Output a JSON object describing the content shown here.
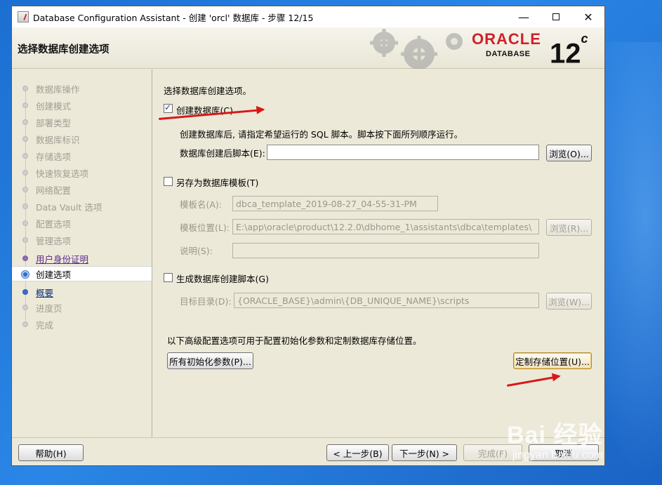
{
  "window": {
    "title": "Database Configuration Assistant - 创建 'orcl' 数据库 - 步骤 12/15",
    "controls": {
      "minimize": "—",
      "maximize": "",
      "close": "✕"
    }
  },
  "banner": {
    "page_title": "选择数据库创建选项",
    "logo_word": "ORACLE",
    "logo_sub": "DATABASE",
    "version": "12",
    "version_suffix": "c"
  },
  "steps": [
    {
      "label": "数据库操作",
      "state": "disabled"
    },
    {
      "label": "创建模式",
      "state": "disabled"
    },
    {
      "label": "部署类型",
      "state": "disabled"
    },
    {
      "label": "数据库标识",
      "state": "disabled"
    },
    {
      "label": "存储选项",
      "state": "disabled"
    },
    {
      "label": "快速恢复选项",
      "state": "disabled"
    },
    {
      "label": "网络配置",
      "state": "disabled"
    },
    {
      "label": "Data Vault 选项",
      "state": "disabled"
    },
    {
      "label": "配置选项",
      "state": "disabled"
    },
    {
      "label": "管理选项",
      "state": "disabled"
    },
    {
      "label": "用户身份证明",
      "state": "visited"
    },
    {
      "label": "创建选项",
      "state": "current"
    },
    {
      "label": "概要",
      "state": "link"
    },
    {
      "label": "进度页",
      "state": "disabled"
    },
    {
      "label": "完成",
      "state": "disabled"
    }
  ],
  "content": {
    "heading": "选择数据库创建选项。",
    "create_db": {
      "label": "创建数据库(C)",
      "checked": true,
      "description": "创建数据库后, 请指定希望运行的 SQL 脚本。脚本按下面所列顺序运行。",
      "script_label": "数据库创建后脚本(E):",
      "script_value": "",
      "browse": "浏览(O)..."
    },
    "save_template": {
      "label": "另存为数据库模板(T)",
      "checked": false,
      "name_label": "模板名(A):",
      "name_value": "dbca_template_2019-08-27_04-55-31-PM",
      "location_label": "模板位置(L):",
      "location_value": "E:\\app\\oracle\\product\\12.2.0\\dbhome_1\\assistants\\dbca\\templates\\",
      "browse": "浏览(R)...",
      "desc_label": "说明(S):",
      "desc_value": ""
    },
    "gen_scripts": {
      "label": "生成数据库创建脚本(G)",
      "checked": false,
      "dir_label": "目标目录(D):",
      "dir_value": "{ORACLE_BASE}\\admin\\{DB_UNIQUE_NAME}\\scripts",
      "browse": "浏览(W)..."
    },
    "advanced_text": "以下高级配置选项可用于配置初始化参数和定制数据库存储位置。",
    "init_params_button": "所有初始化参数(P)...",
    "custom_storage_button": "定制存储位置(U)..."
  },
  "footer": {
    "help": "帮助(H)",
    "back": "< 上一步(B)",
    "next": "下一步(N) >",
    "finish": "完成(F)",
    "cancel": "取消"
  },
  "watermark": {
    "main": "Bai 经验",
    "sub": "jingyan.baidu.com"
  },
  "colors": {
    "accent": "#d0202a",
    "window_bg": "#ece9d8",
    "desktop": "#1c6fd1",
    "annotation_arrow": "#d81818"
  }
}
